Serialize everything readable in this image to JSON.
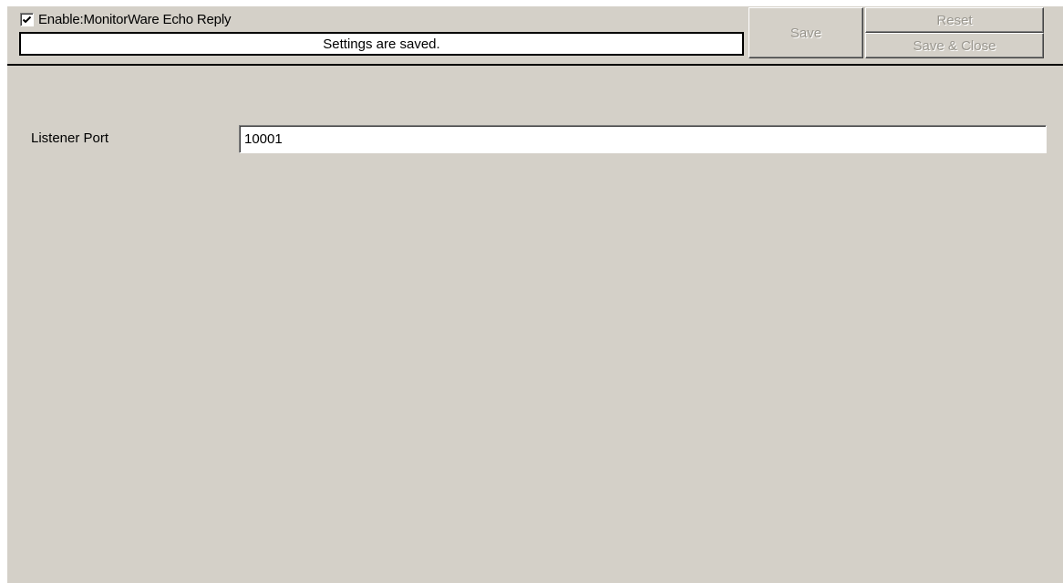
{
  "header": {
    "enable_checkbox_checked": true,
    "enable_label": "Enable:MonitorWare Echo Reply",
    "status_text": "Settings are saved."
  },
  "buttons": {
    "save_label": "Save",
    "reset_label": "Reset",
    "save_close_label": "Save & Close",
    "disabled": true
  },
  "form": {
    "listener_port_label": "Listener Port",
    "listener_port_value": "10001"
  },
  "colors": {
    "panel_background": "#d4d0c8",
    "disabled_text": "#9a978f",
    "field_background": "#ffffff"
  }
}
